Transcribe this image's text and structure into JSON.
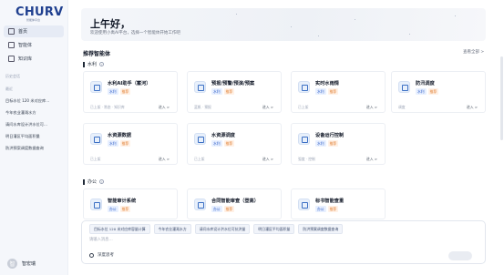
{
  "logo": {
    "text": "CHURV",
    "subtitle": "智能体平台"
  },
  "nav": [
    {
      "label": "首页",
      "icon": "home-icon",
      "active": true
    },
    {
      "label": "智能体",
      "icon": "agent-icon",
      "active": false
    },
    {
      "label": "知识库",
      "icon": "book-icon",
      "active": false
    }
  ],
  "sidebar_section": "历史会话",
  "history_title": "最近",
  "history": [
    "目标水位 120 米对应库…",
    "今年农业灌溉水方",
    "请问水库设计洪水位可…",
    "明日灌区平均面积量",
    "防洪预案调度数据查询"
  ],
  "user": {
    "name": "智宏瑞",
    "initial": "智"
  },
  "hero": {
    "greeting": "上午好，",
    "subtitle": "欢迎使用小禹AI平台，选择一个智能体开始工作吧"
  },
  "recommend": {
    "title": "推荐智能体",
    "view_all": "查看全部 >"
  },
  "categories": [
    {
      "label": "水利",
      "cards": [
        {
          "name": "水利AI助手（蓄河）",
          "tags": [
            "水利",
            "推荐"
          ],
          "meta": "已上架 · 常态 · 知识库",
          "enter": "进入 >"
        },
        {
          "name": "预报/预警/预演/预案",
          "tags": [
            "水利",
            "推荐"
          ],
          "meta": "蓝帆 · 预报",
          "enter": "进入 >"
        },
        {
          "name": "实时水雨情",
          "tags": [
            "水利",
            "推荐"
          ],
          "meta": "已上架",
          "enter": "进入 >"
        },
        {
          "name": "防汛调度",
          "tags": [
            "水利",
            "推荐"
          ],
          "meta": "调度",
          "enter": "进入 >"
        },
        {
          "name": "水资源数据",
          "tags": [
            "水利",
            "推荐"
          ],
          "meta": "已上架",
          "enter": "进入 >"
        },
        {
          "name": "水资源调度",
          "tags": [
            "水利",
            "推荐"
          ],
          "meta": "已上架",
          "enter": "进入 >"
        },
        {
          "name": "设备运行控制",
          "tags": [
            "水利",
            "推荐"
          ],
          "meta": "弧度 · 控制",
          "enter": "进入 >"
        }
      ]
    },
    {
      "label": "办公",
      "cards": [
        {
          "name": "智能审计系统",
          "tags": [
            "办公",
            "推荐"
          ]
        },
        {
          "name": "合同智能审查（登高）",
          "tags": [
            "办公",
            "推荐"
          ]
        },
        {
          "name": "标书智能查重",
          "tags": [
            "办公",
            "推荐"
          ]
        }
      ]
    }
  ],
  "composer": {
    "chips": [
      "目标水位 120 米对应库容量计算",
      "今年农业灌溉水方",
      "请问水库设计洪水位可抗洪量",
      "明日灌区平均面积量",
      "防洪预案调度数据查询"
    ],
    "placeholder": "请输入消息…",
    "deep_think": "深度思考"
  },
  "colors": {
    "accent": "#3563c9",
    "tag_blue_bg": "#e8f0ff",
    "tag_orange": "#e07b2c"
  }
}
